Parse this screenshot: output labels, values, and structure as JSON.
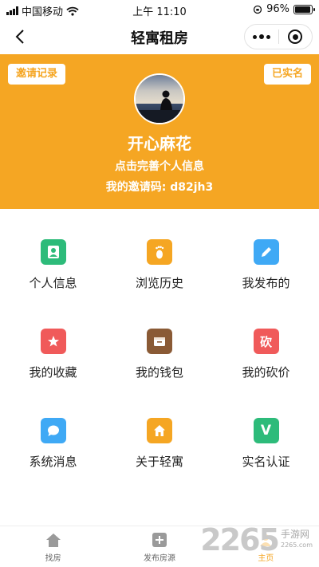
{
  "status_bar": {
    "carrier": "中国移动",
    "time": "上午 11:10",
    "battery": "96%",
    "battery_level": 0.96
  },
  "nav": {
    "title": "轻寓租房"
  },
  "profile": {
    "invite_records_label": "邀请记录",
    "verified_label": "已实名",
    "username": "开心麻花",
    "complete_info_label": "点击完善个人信息",
    "invite_code_text": "我的邀请码: d82jh3"
  },
  "menu": [
    {
      "label": "个人信息",
      "icon": "user-icon",
      "color": "#2dbb7a"
    },
    {
      "label": "浏览历史",
      "icon": "footprint-icon",
      "color": "#f5a623"
    },
    {
      "label": "我发布的",
      "icon": "pencil-icon",
      "color": "#3fa9f5"
    },
    {
      "label": "我的收藏",
      "icon": "star-icon",
      "color": "#f05a5a"
    },
    {
      "label": "我的钱包",
      "icon": "wallet-icon",
      "color": "#8a5a35"
    },
    {
      "label": "我的砍价",
      "icon": "bargain-icon",
      "color": "#f05a5a",
      "glyph": "砍"
    },
    {
      "label": "系统消息",
      "icon": "message-icon",
      "color": "#3fa9f5"
    },
    {
      "label": "关于轻寓",
      "icon": "house-icon",
      "color": "#f5a623"
    },
    {
      "label": "实名认证",
      "icon": "verify-icon",
      "color": "#2dbb7a",
      "glyph": "V"
    }
  ],
  "tabs": [
    {
      "label": "找房",
      "icon": "home-icon"
    },
    {
      "label": "发布房源",
      "icon": "plus-square-icon"
    },
    {
      "label": "主页",
      "icon": "profile-icon",
      "active": true
    }
  ],
  "watermark": {
    "number": "2265",
    "cn": "手游网",
    "en": "2265.com"
  },
  "colors": {
    "accent": "#f5a623"
  }
}
